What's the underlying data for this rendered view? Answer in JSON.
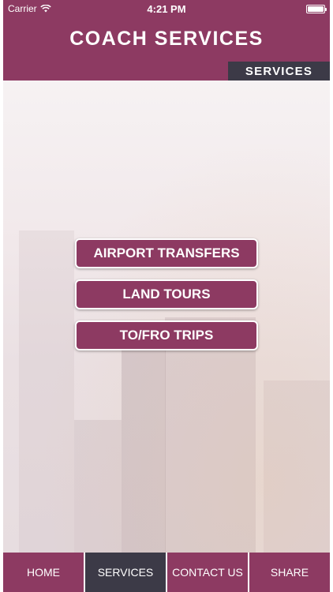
{
  "status_bar": {
    "carrier": "Carrier",
    "time": "4:21 PM",
    "wifi_icon": "wifi-icon",
    "battery_icon": "battery-icon",
    "battery_level": 1.0
  },
  "header": {
    "title": "COACH SERVICES",
    "section_tab": "SERVICES"
  },
  "colors": {
    "brand": "#8d3a62",
    "dark": "#3c3a47",
    "text": "#ffffff"
  },
  "menu": {
    "buttons": [
      {
        "label": "AIRPORT TRANSFERS"
      },
      {
        "label": "LAND TOURS"
      },
      {
        "label": "TO/FRO TRIPS"
      }
    ]
  },
  "tab_bar": {
    "active": "SERVICES",
    "items": [
      {
        "label": "HOME"
      },
      {
        "label": "SERVICES"
      },
      {
        "label": "CONTACT US"
      },
      {
        "label": "SHARE"
      }
    ]
  }
}
